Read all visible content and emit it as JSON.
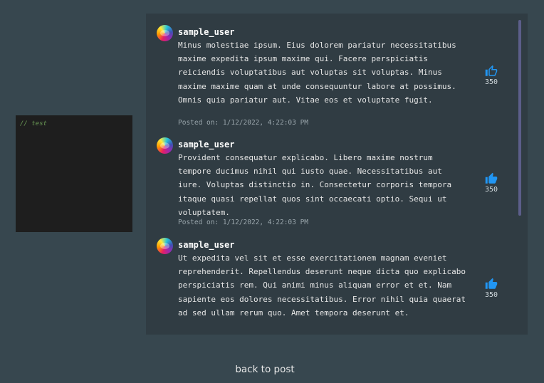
{
  "editor": {
    "code": "// test"
  },
  "comments": [
    {
      "username": "sample_user",
      "text": "Minus molestiae ipsum. Eius dolorem pariatur necessitatibus maxime expedita ipsum maxime qui. Facere perspiciatis reiciendis voluptatibus aut voluptas sit voluptas. Minus maxime maxime quam at unde consequuntur labore at possimus. Omnis quia pariatur aut. Vitae eos et voluptate fugit.",
      "posted": "Posted on: 1/12/2022, 4:22:03 PM",
      "likes": "350",
      "like_style": "outline"
    },
    {
      "username": "sample_user",
      "text": "Provident consequatur explicabo. Libero maxime nostrum tempore ducimus nihil qui iusto quae. Necessitatibus aut iure. Voluptas distinctio in. Consectetur corporis tempora itaque quasi repellat quos sint occaecati optio. Sequi ut voluptatem.",
      "posted": "Posted on: 1/12/2022, 4:22:03 PM",
      "likes": "350",
      "like_style": "filled"
    },
    {
      "username": "sample_user",
      "text": "Ut expedita vel sit et esse exercitationem magnam eveniet reprehenderit. Repellendus deserunt neque dicta quo explicabo perspiciatis rem. Qui animi minus aliquam error et et. Nam sapiente eos dolores necessitatibus. Error nihil quia quaerat ad sed ullam rerum quo. Amet tempora deserunt et.",
      "posted": "",
      "likes": "350",
      "like_style": "filled"
    }
  ],
  "footer": {
    "back_label": "back to post"
  },
  "colors": {
    "accent": "#2196f3",
    "background": "#37474f",
    "panel": "#303c43"
  }
}
